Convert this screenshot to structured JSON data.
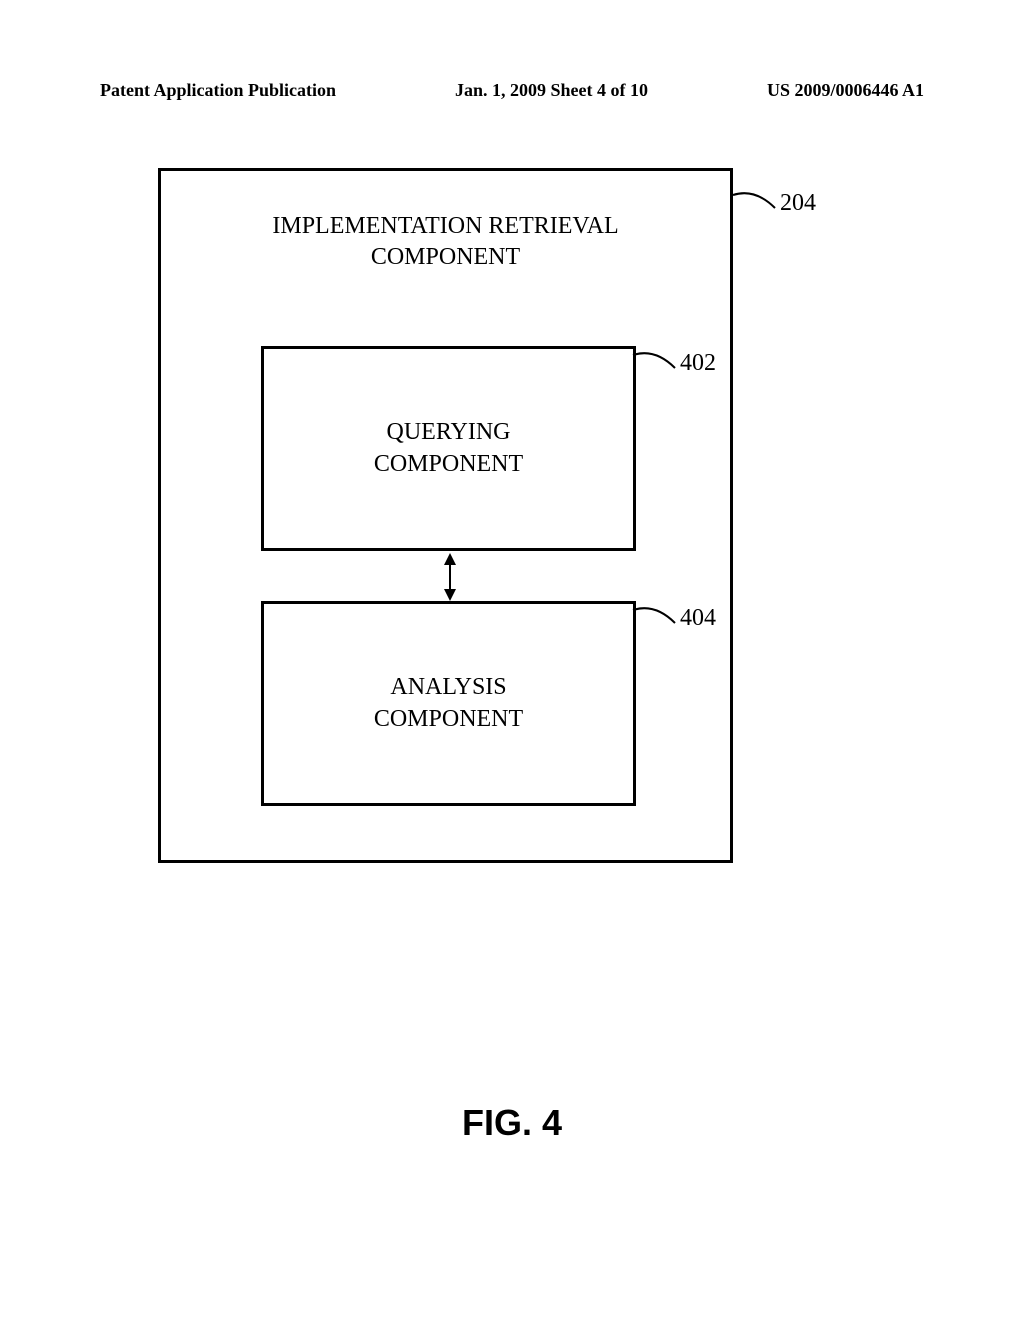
{
  "header": {
    "left": "Patent Application Publication",
    "center": "Jan. 1, 2009   Sheet 4 of 10",
    "right": "US 2009/0006446 A1"
  },
  "diagram": {
    "outer_title_line1": "IMPLEMENTATION RETRIEVAL",
    "outer_title_line2": "COMPONENT",
    "querying_line1": "QUERYING",
    "querying_line2": "COMPONENT",
    "analysis_line1": "ANALYSIS",
    "analysis_line2": "COMPONENT"
  },
  "labels": {
    "outer": "204",
    "inner_top": "402",
    "inner_bottom": "404"
  },
  "figure_caption": "FIG. 4"
}
